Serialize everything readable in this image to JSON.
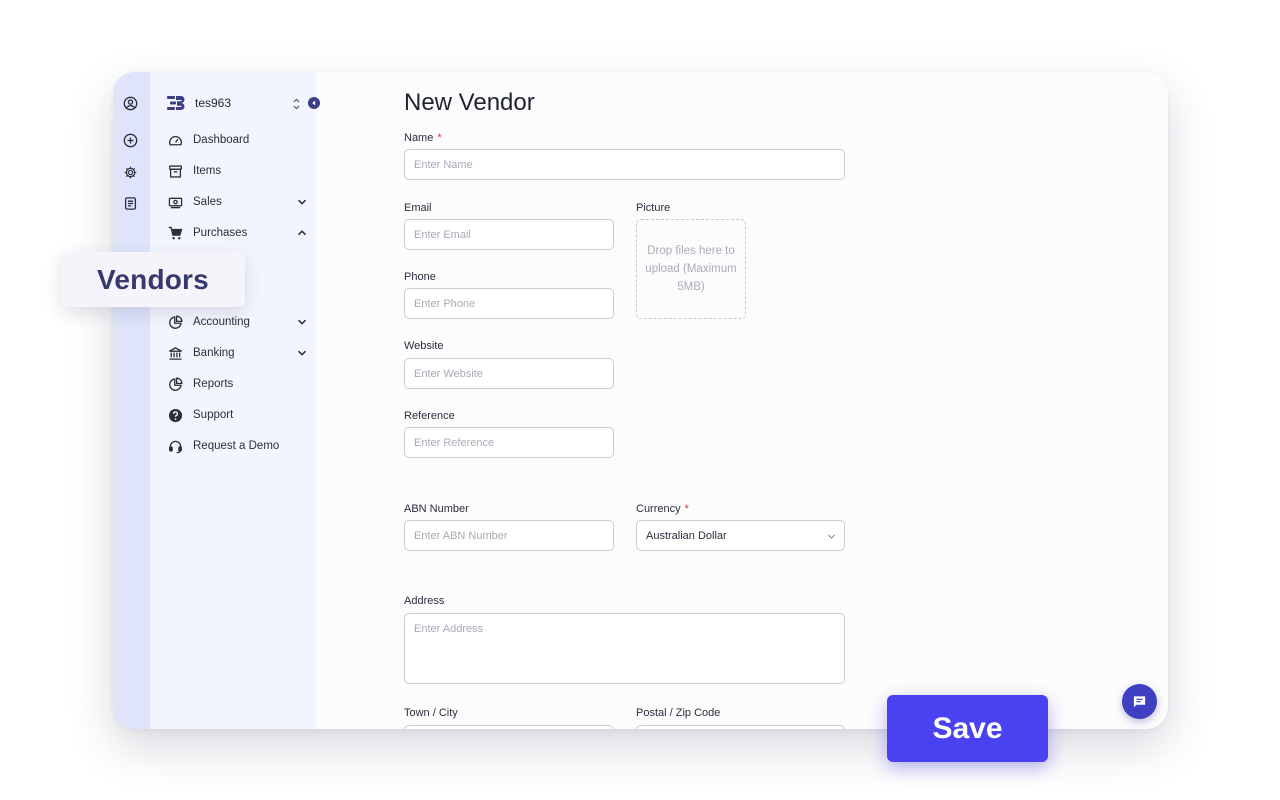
{
  "sidebar": {
    "org_name": "tes963",
    "items": [
      {
        "label": "Dashboard",
        "icon": "speedometer-icon"
      },
      {
        "label": "Items",
        "icon": "archive-box-icon"
      },
      {
        "label": "Sales",
        "icon": "cash-icon"
      },
      {
        "label": "Purchases",
        "icon": "shopping-cart-icon"
      },
      {
        "label": "Accounting",
        "icon": "pie-chart-icon"
      },
      {
        "label": "Banking",
        "icon": "bank-icon"
      },
      {
        "label": "Reports",
        "icon": "report-chart-icon"
      },
      {
        "label": "Support",
        "icon": "question-circle-icon"
      },
      {
        "label": "Request a Demo",
        "icon": "headset-icon"
      }
    ]
  },
  "callout": {
    "label": "Vendors"
  },
  "form": {
    "title": "New Vendor",
    "name": {
      "label": "Name",
      "required_mark": "*",
      "placeholder": "Enter Name"
    },
    "email": {
      "label": "Email",
      "placeholder": "Enter Email"
    },
    "phone": {
      "label": "Phone",
      "placeholder": "Enter Phone"
    },
    "website": {
      "label": "Website",
      "placeholder": "Enter Website"
    },
    "reference": {
      "label": "Reference",
      "placeholder": "Enter Reference"
    },
    "picture": {
      "label": "Picture",
      "dropzone_text": "Drop files here to upload (Maximum 5MB)"
    },
    "abn": {
      "label": "ABN Number",
      "placeholder": "Enter ABN Number"
    },
    "currency": {
      "label": "Currency",
      "required_mark": "*",
      "value": "Australian Dollar"
    },
    "address": {
      "label": "Address",
      "placeholder": "Enter Address"
    },
    "town": {
      "label": "Town / City"
    },
    "postal": {
      "label": "Postal / Zip Code"
    }
  },
  "actions": {
    "save_label": "Save"
  },
  "colors": {
    "accent": "#4a42f0",
    "rail": "#dfe4fb",
    "sidebar": "#f3f5fe",
    "required": "#d93a3a"
  }
}
